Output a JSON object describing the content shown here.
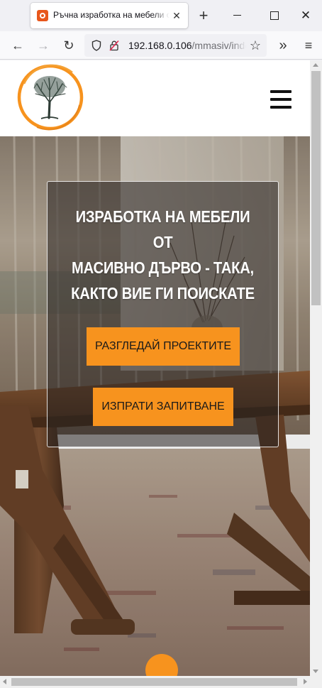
{
  "browser": {
    "tab": {
      "title": "Ръчна изработка на мебели от масивно дърво",
      "favicon": "xampp-favicon-icon",
      "close_glyph": "✕"
    },
    "new_tab_glyph": "+",
    "window": {
      "close_glyph": "✕"
    },
    "nav": {
      "back_glyph": "←",
      "forward_glyph": "→",
      "reload_glyph": "↻",
      "overflow_glyph": "»",
      "menu_glyph": "≡"
    },
    "url": {
      "host": "192.168.0.106",
      "path": "/mmasiv/index.php"
    },
    "bookmark_glyph": "☆"
  },
  "site": {
    "accent_color": "#f7931e",
    "logo": "tree-in-circle-logo",
    "menu_icon": "hamburger-icon",
    "hero": {
      "title_line1": "ИЗРАБОТКА НА МЕБЕЛИ ОТ",
      "title_line2": "МАСИВНО ДЪРВО - ТАКА,",
      "title_line3": "КАКТО ВИЕ ГИ ПОИСКАТЕ",
      "primary_button": "РАЗГЛЕДАЙ ПРОЕКТИТЕ",
      "secondary_button": "ИЗПРАТИ ЗАПИТВАНЕ"
    }
  }
}
